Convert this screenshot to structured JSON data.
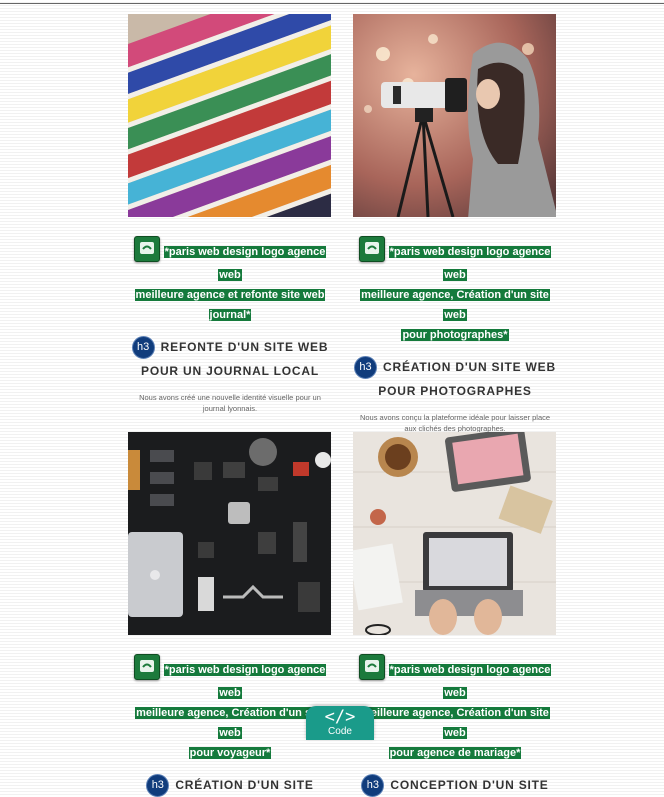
{
  "cards": [
    {
      "image_alt": "Pile de magazines colorés",
      "link_alt_line1": "*paris web design logo agence web",
      "link_alt_line2": "meilleure agence et refonte site web",
      "link_alt_line3": "journal*",
      "h3_badge": "h3",
      "title_line1": "REFONTE D'UN SITE WEB",
      "title_line2": "POUR UN JOURNAL LOCAL",
      "description": "Nous avons créé une nouvelle identité visuelle pour un journal lyonnais."
    },
    {
      "image_alt": "Photographe avec appareil sur trépied",
      "link_alt_line1": "*paris web design logo agence web",
      "link_alt_line2": "meilleure agence, Création d'un site web",
      "link_alt_line3": "pour photographes*",
      "h3_badge": "h3",
      "title_line1": "CRÉATION D'UN SITE WEB",
      "title_line2": "POUR PHOTOGRAPHES",
      "description": "Nous avons conçu la plateforme idéale pour laisser place aux clichés des photographes."
    },
    {
      "image_alt": "Équipement photo et drone vu de dessus",
      "link_alt_line1": "*paris web design logo agence web",
      "link_alt_line2": "meilleure agence, Création d'un site web",
      "link_alt_line3": "pour voyageur*",
      "h3_badge": "h3",
      "title_line1": "CRÉATION D'UN SITE",
      "title_line2": "",
      "description": ""
    },
    {
      "image_alt": "Bureau avec ordinateur portable et café",
      "link_alt_line1": "*paris web design logo agence web",
      "link_alt_line2": "meilleure agence, Création d'un site web",
      "link_alt_line3": "pour agence de mariage*",
      "h3_badge": "h3",
      "title_line1": "CONCEPTION D'UN SITE",
      "title_line2": "",
      "description": ""
    }
  ],
  "code_tab": {
    "glyph": "</>",
    "label": "Code"
  },
  "colors": {
    "alt_highlight": "#157a3c",
    "h3_badge": "#103c7c",
    "code_tab": "#1a9b8a"
  }
}
